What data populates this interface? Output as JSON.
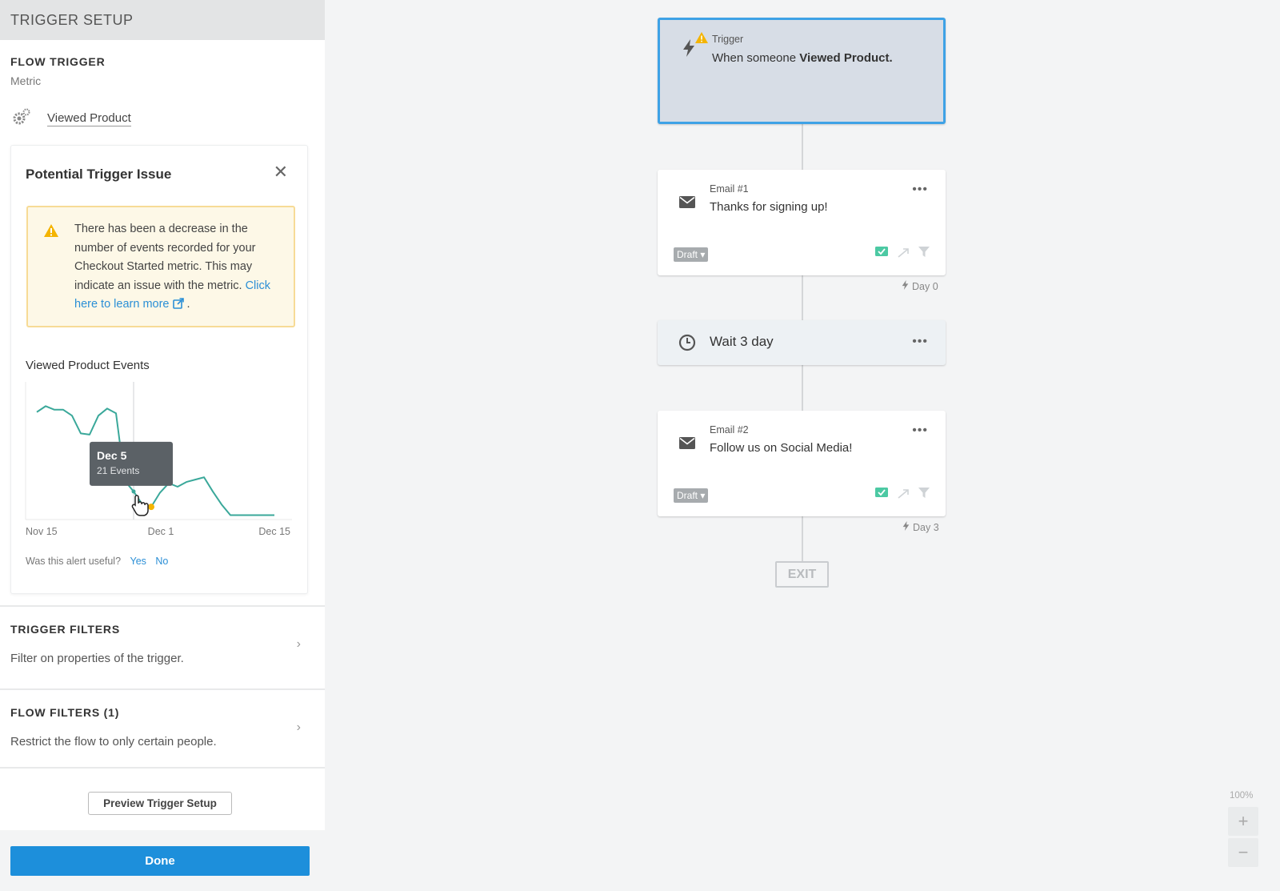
{
  "sidebar": {
    "header": "TRIGGER SETUP",
    "flow_trigger": {
      "title": "FLOW TRIGGER",
      "type": "Metric",
      "metric": "Viewed Product"
    },
    "issue": {
      "title": "Potential Trigger Issue",
      "warning_text": "There has been a decrease in the number of events recorded for your Checkout Started metric. This may indicate an issue with the metric.",
      "link_text": "Click here to learn more",
      "link_suffix": ".",
      "chart_title": "Viewed Product Events",
      "tooltip_date": "Dec 5",
      "tooltip_value": "21 Events",
      "useful_question": "Was this alert useful?",
      "yes": "Yes",
      "no": "No"
    },
    "trigger_filters": {
      "title": "TRIGGER FILTERS",
      "desc": "Filter on properties of the trigger."
    },
    "flow_filters": {
      "title": "FLOW FILTERS (1)",
      "desc": "Restrict the flow to only certain people."
    },
    "preview_label": "Preview Trigger Setup",
    "done_label": "Done"
  },
  "chart_data": {
    "type": "line",
    "title": "Viewed Product Events",
    "x_tick_labels": [
      "Nov 15",
      "Dec 1",
      "Dec 15"
    ],
    "series": [
      {
        "values": [
          88,
          93,
          90,
          90,
          85,
          70,
          69,
          85,
          91,
          87,
          30,
          21,
          10,
          8,
          20,
          28,
          25,
          29,
          31,
          33,
          21,
          10,
          1,
          1,
          1,
          1,
          1,
          1
        ]
      }
    ],
    "highlight": {
      "label": "Dec 5",
      "value": 21
    },
    "ylim": [
      0,
      100
    ],
    "line_color": "#3aa89a",
    "marker_color": "#f4b400",
    "grid": false
  },
  "canvas": {
    "trigger": {
      "label": "Trigger",
      "text_prefix": "When someone ",
      "text_bold": "Viewed Product."
    },
    "email1": {
      "label": "Email #1",
      "subject": "Thanks for signing up!",
      "status": "Draft",
      "day": "Day 0"
    },
    "wait": {
      "text": "Wait 3 day"
    },
    "email2": {
      "label": "Email #2",
      "subject": "Follow us on Social Media!",
      "status": "Draft",
      "day": "Day 3"
    },
    "exit_label": "EXIT",
    "more_label": "•••",
    "zoom": "100%",
    "zoom_in": "+",
    "zoom_out": "−"
  },
  "colors": {
    "accent": "#1d8fdb",
    "warning_bg": "#fdf8e7",
    "warning_border": "#f7db96",
    "selected_border": "#3ea2e6"
  },
  "icons": [
    "gear-icon",
    "close-icon",
    "warning-icon",
    "external-link-icon",
    "hand-cursor-icon",
    "chevron-right-icon",
    "bolt-icon",
    "envelope-icon",
    "clock-icon",
    "more-icon",
    "approval-icon",
    "smart-send-icon",
    "filter-icon",
    "plus-icon",
    "minus-icon"
  ]
}
